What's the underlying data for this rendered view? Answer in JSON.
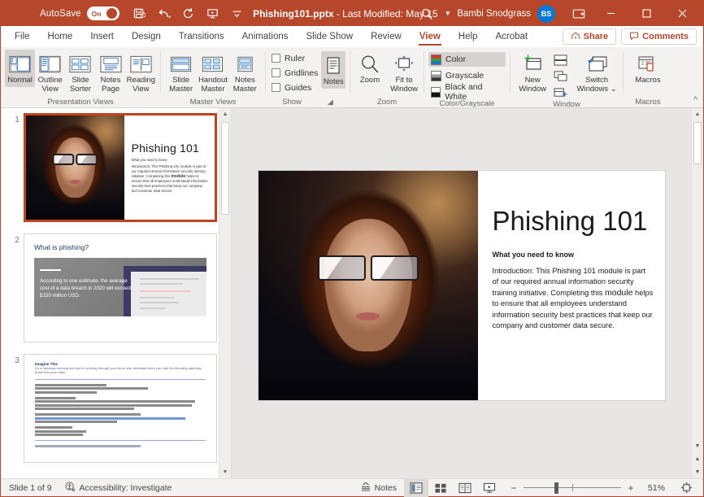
{
  "titlebar": {
    "autosave_label": "AutoSave",
    "autosave_state": "On",
    "doc_title": "Phishing101.pptx",
    "doc_modified": "- Last Modified: May 15",
    "user_name": "Bambi Snodgrass",
    "user_initials": "BS",
    "quick_access": [
      {
        "name": "save-icon",
        "tooltip": "Save"
      },
      {
        "name": "undo-icon",
        "tooltip": "Undo"
      },
      {
        "name": "redo-icon",
        "tooltip": "Redo"
      },
      {
        "name": "start-presentation-icon",
        "tooltip": "Start From Beginning"
      },
      {
        "name": "customize-quick-access-toolbar-icon",
        "tooltip": "Customize Quick Access Toolbar"
      }
    ],
    "window_buttons": [
      "minimize",
      "maximize",
      "close"
    ],
    "accent_color": "#b7472a",
    "avatar_color": "#0078d4"
  },
  "tabs": [
    {
      "label": "File",
      "active": false
    },
    {
      "label": "Home",
      "active": false
    },
    {
      "label": "Insert",
      "active": false
    },
    {
      "label": "Design",
      "active": false
    },
    {
      "label": "Transitions",
      "active": false
    },
    {
      "label": "Animations",
      "active": false
    },
    {
      "label": "Slide Show",
      "active": false
    },
    {
      "label": "Review",
      "active": false
    },
    {
      "label": "View",
      "active": true
    },
    {
      "label": "Help",
      "active": false
    },
    {
      "label": "Acrobat",
      "active": false
    }
  ],
  "tabbar_right": {
    "share_label": "Share",
    "comments_label": "Comments"
  },
  "ribbon": {
    "groups": [
      {
        "name": "presentation-views",
        "label": "Presentation Views",
        "buttons": [
          {
            "label": "Normal",
            "label2": "",
            "icon": "normal-view-icon",
            "active": true
          },
          {
            "label": "Outline",
            "label2": "View",
            "icon": "outline-view-icon",
            "active": false
          },
          {
            "label": "Slide",
            "label2": "Sorter",
            "icon": "slide-sorter-icon",
            "active": false
          },
          {
            "label": "Notes",
            "label2": "Page",
            "icon": "notes-page-icon",
            "active": false
          },
          {
            "label": "Reading",
            "label2": "View",
            "icon": "reading-view-icon",
            "active": false
          }
        ]
      },
      {
        "name": "master-views",
        "label": "Master Views",
        "buttons": [
          {
            "label": "Slide",
            "label2": "Master",
            "icon": "slide-master-icon",
            "active": false
          },
          {
            "label": "Handout",
            "label2": "Master",
            "icon": "handout-master-icon",
            "active": false
          },
          {
            "label": "Notes",
            "label2": "Master",
            "icon": "notes-master-icon",
            "active": false
          }
        ]
      },
      {
        "name": "show",
        "label": "Show",
        "checkboxes": [
          {
            "label": "Ruler",
            "checked": false
          },
          {
            "label": "Gridlines",
            "checked": false
          },
          {
            "label": "Guides",
            "checked": false
          }
        ],
        "notes_button": {
          "label": "Notes",
          "icon": "notes-icon",
          "active": true
        },
        "has_dialog_launcher": true
      },
      {
        "name": "zoom",
        "label": "Zoom",
        "buttons": [
          {
            "label": "Zoom",
            "label2": "",
            "icon": "magnifier-icon",
            "active": false
          },
          {
            "label": "Fit to",
            "label2": "Window",
            "icon": "fit-to-window-icon",
            "active": false
          }
        ]
      },
      {
        "name": "color-grayscale",
        "label": "Color/Grayscale",
        "options": [
          {
            "label": "Color",
            "swatch": "color",
            "active": true
          },
          {
            "label": "Grayscale",
            "swatch": "grayscale",
            "active": false
          },
          {
            "label": "Black and White",
            "swatch": "blackwhite",
            "active": false
          }
        ]
      },
      {
        "name": "window",
        "label": "Window",
        "buttons": [
          {
            "label": "New",
            "label2": "Window",
            "icon": "new-window-icon",
            "active": false
          },
          {
            "label": "Switch",
            "label2": "Windows",
            "icon": "switch-windows-icon",
            "active": false,
            "dropdown": true
          }
        ],
        "mini_buttons": [
          {
            "name": "arrange-all-icon"
          },
          {
            "name": "cascade-icon"
          },
          {
            "name": "move-split-icon"
          }
        ]
      },
      {
        "name": "macros",
        "label": "Macros",
        "buttons": [
          {
            "label": "Macros",
            "label2": "",
            "icon": "macros-icon",
            "active": false
          }
        ]
      }
    ],
    "collapse_label": "Collapse the Ribbon"
  },
  "thumbnails": [
    {
      "number": "1",
      "selected": true,
      "title": "Phishing 101",
      "subtitle": "What you need to know",
      "body_pre": "Introduction: This Phishing 101 module is part of our required annual information security training initiative. Completing this ",
      "body_bold": "module",
      "body_post": " helps to ensure that all employees understand information security best practices that keep our company and customer data secure."
    },
    {
      "number": "2",
      "selected": false,
      "title": "What is phishing?",
      "quote": "According to one estimate, the average cost of a data breach in 2020 will exceed $150 million USD."
    },
    {
      "number": "3",
      "selected": false,
      "heading": "Imagine This",
      "intro": "It's a Saturday morning and you're scrolling through your inbox over breakfast when you note the following alarming email from your bank.",
      "email_from": "From: Alert Police Bank",
      "email_subject": "Subject: Please update your account information",
      "email_date": "Date: February 6, 2020",
      "email_greeting": "Dear Customer,",
      "email_body": "As a courtesy to our most valued customers, Alert Police Bank regularly conducts account reviews to verify the accuracy of customer information. During our most recent review, we found that we could not verify some of your information.",
      "email_action": "In order to maintain the security of your account, please visit",
      "email_link": "http://www.alertpolicebank.com/accounts/update",
      "email_action2": "to update your information within 48 hours. If not, it's a 30 day account suspension.",
      "email_sign": "Sincerely,",
      "email_title": "Account Security",
      "email_bank": "Alert Police Bank",
      "footer": "A 30-day suspension? Naturally you're going to click that link right away."
    }
  ],
  "slide": {
    "title": "Phishing 101",
    "subtitle": "What you need to know",
    "body_pre": "Introduction: This Phishing 101 module is part of our required annual information security training initiative. Completing this ",
    "body_bold": "module",
    "body_post": " helps to ensure that all employees understand information security best practices that keep our company and customer data secure.",
    "image_alt": "woman-wearing-glasses-at-computer-photo"
  },
  "status": {
    "slide_counter": "Slide 1 of 9",
    "accessibility": "Accessibility: Investigate",
    "notes_label": "Notes",
    "views": [
      {
        "name": "normal-view-button",
        "active": true
      },
      {
        "name": "slide-sorter-button",
        "active": false
      },
      {
        "name": "reading-view-button",
        "active": false
      },
      {
        "name": "slide-show-button",
        "active": false
      }
    ],
    "zoom_out": "−",
    "zoom_in": "+",
    "zoom_level": "51%",
    "fit_button": "fit-slide-to-window-button"
  }
}
